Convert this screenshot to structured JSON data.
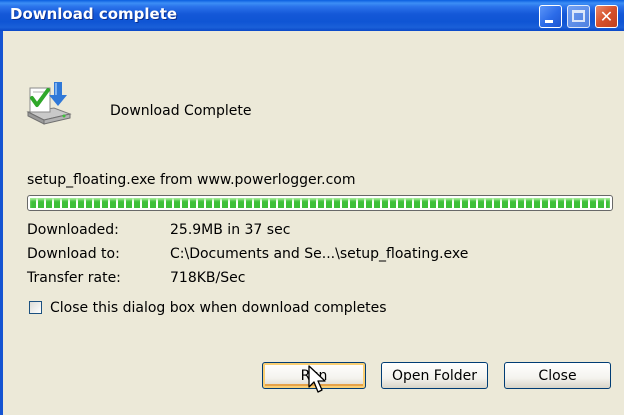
{
  "window": {
    "title": "Download complete",
    "controls": {
      "minimize": "minimize-icon",
      "maximize": "maximize-icon",
      "close": "close-icon"
    }
  },
  "header": {
    "text": "Download Complete",
    "icon": "download-icon"
  },
  "source_line": "setup_floating.exe from www.powerlogger.com",
  "progress": {
    "fraction": 1.0,
    "color": "#3fbf3a"
  },
  "details": {
    "downloaded_label": "Downloaded:",
    "downloaded_value": "25.9MB in 37 sec",
    "download_to_label": "Download to:",
    "download_to_value": "C:\\Documents and Se...\\setup_floating.exe",
    "transfer_rate_label": "Transfer rate:",
    "transfer_rate_value": "718KB/Sec"
  },
  "option": {
    "label": "Close this dialog box when download completes",
    "checked": false
  },
  "buttons": {
    "run": "Run",
    "open_folder": "Open Folder",
    "close": "Close"
  },
  "colors": {
    "titlebar": "#0f55d4",
    "dialog_bg": "#ece9d8",
    "progress_green": "#3fbf3a"
  }
}
